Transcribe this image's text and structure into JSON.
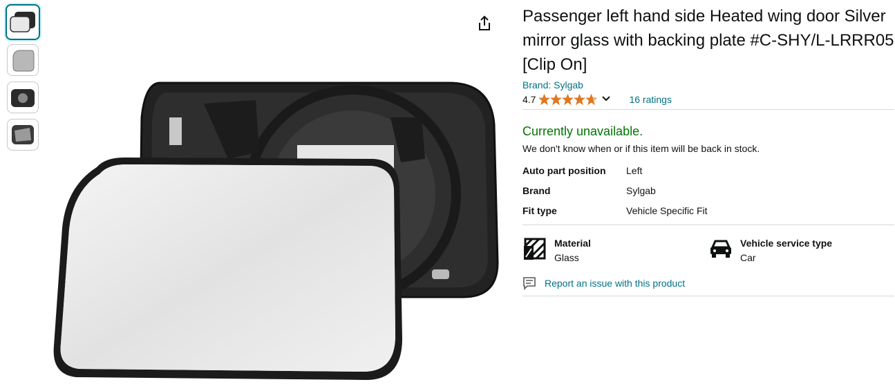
{
  "product": {
    "title": "Passenger left hand side Heated wing door Silver mirror glass with backing plate #C-SHY/L-LRRR05 [Clip On]",
    "brand_link": "Brand: Sylgab",
    "rating_value": "4.7",
    "rating_stars": 4.7,
    "ratings_count": "16 ratings"
  },
  "availability": {
    "status": "Currently unavailable.",
    "note": "We don't know when or if this item will be back in stock."
  },
  "specs": [
    {
      "key": "Auto part position",
      "value": "Left"
    },
    {
      "key": "Brand",
      "value": "Sylgab"
    },
    {
      "key": "Fit type",
      "value": "Vehicle Specific Fit"
    }
  ],
  "features": [
    {
      "title": "Material",
      "value": "Glass",
      "icon": "glass-material-icon"
    },
    {
      "title": "Vehicle service type",
      "value": "Car",
      "icon": "car-icon"
    }
  ],
  "report_link": "Report an issue with this product",
  "colors": {
    "link": "#007185",
    "available": "#007600",
    "star": "#de7921",
    "selected_thumb": "#007185"
  }
}
